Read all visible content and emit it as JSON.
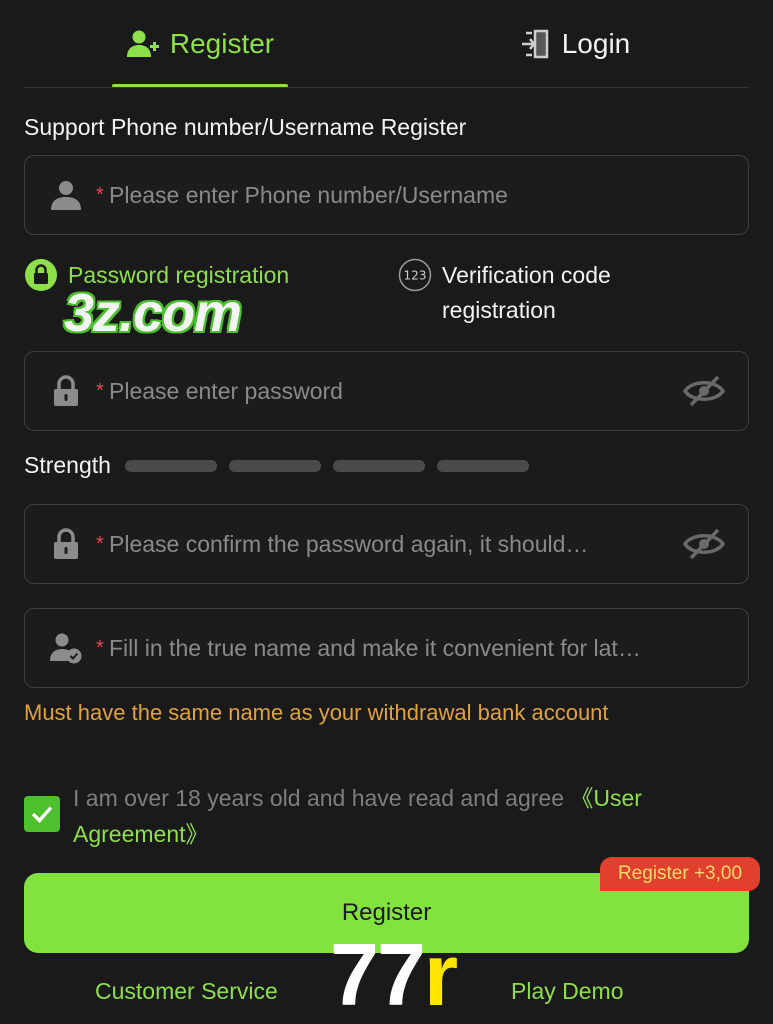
{
  "tabs": {
    "register_label": "Register",
    "login_label": "Login",
    "active": "register"
  },
  "section_title": "Support Phone number/Username Register",
  "fields": {
    "username": {
      "required_mark": "*",
      "placeholder": "Please enter Phone number/Username",
      "value": ""
    },
    "password": {
      "required_mark": "*",
      "placeholder": "Please enter password",
      "value": ""
    },
    "confirm_password": {
      "required_mark": "*",
      "placeholder": "Please confirm the password again, it should…",
      "value": ""
    },
    "real_name": {
      "required_mark": "*",
      "placeholder": "Fill in the true name and make it convenient for lat…",
      "value": ""
    }
  },
  "modes": {
    "password_label": "Password registration",
    "code_line1": "Verification code",
    "code_line2": "registration",
    "code_icon_text": "123",
    "selected": "password"
  },
  "strength": {
    "label": "Strength",
    "level": 0,
    "segments": 4
  },
  "warning": "Must have the same name as your withdrawal bank account",
  "agreement": {
    "text": "I am over 18 years old and have read and agree ",
    "link": "《User Agreement》",
    "checked": true
  },
  "register_button": "Register",
  "bonus_badge": "Register +3,00",
  "footer": {
    "customer_service": "Customer Service",
    "play_demo": "Play Demo"
  },
  "watermarks": {
    "site": "3z.com",
    "brand_white": "77",
    "brand_yellow": "r"
  },
  "colors": {
    "accent": "#8ee04a",
    "button": "#82e23e",
    "warning": "#e0a23c",
    "required": "#e24a4a",
    "badge": "#e2402f",
    "background": "#1a1a1a"
  }
}
